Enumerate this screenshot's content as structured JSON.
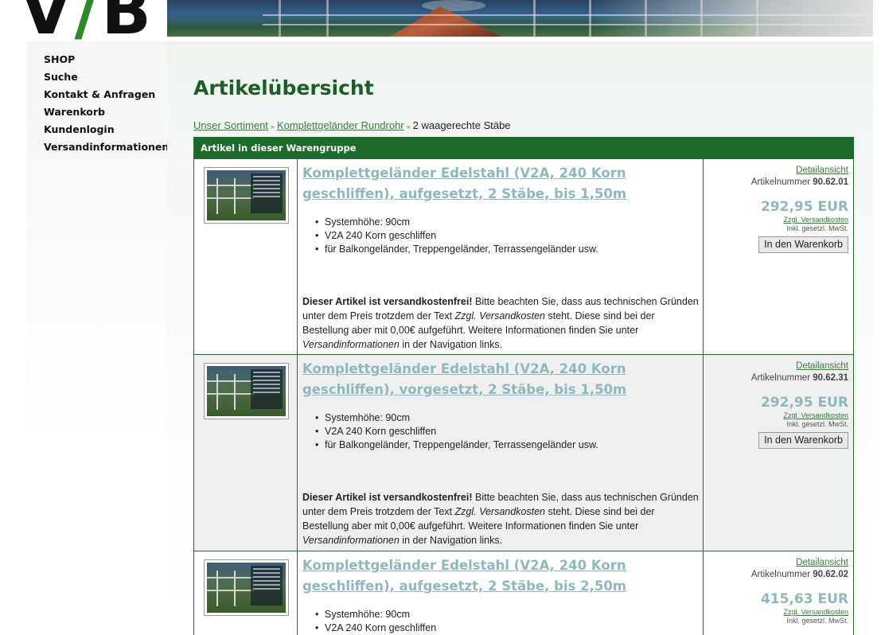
{
  "header": {
    "logo_text": "V/B"
  },
  "sidebar": {
    "items": [
      {
        "label": "SHOP"
      },
      {
        "label": "Suche"
      },
      {
        "label": "Kontakt & Anfragen"
      },
      {
        "label": "Warenkorb"
      },
      {
        "label": "Kundenlogin"
      },
      {
        "label": "Versandinformationen"
      }
    ]
  },
  "main": {
    "title": "Artikelübersicht",
    "breadcrumb": {
      "link1": "Unser Sortiment",
      "link2": "Komplettgeländer Rundrohr",
      "current": "2 waagerechte Stäbe",
      "separator": "»"
    },
    "table_header": "Artikel in dieser Warengruppe",
    "products": [
      {
        "title": "Komplettgeländer Edelstahl (V2A, 240 Korn geschliffen), aufgesetzt, 2 Stäbe, bis 1,50m",
        "features": [
          "Systemhöhe: 90cm",
          "V2A 240 Korn geschliffen",
          "für Balkongeländer, Treppengeländer, Terrassengeländer usw."
        ],
        "note_bold": "Dieser Artikel ist versandkostenfrei!",
        "note_text1": " Bitte beachten Sie, dass aus technischen Gründen unter dem Preis trotzdem der Text ",
        "note_italic1": "Zzgl. Versandkosten",
        "note_text2": " steht. Diese sind bei der Bestellung aber mit 0,00€ aufgeführt. Weitere Informationen finden Sie unter ",
        "note_italic2": "Versandinformationen",
        "note_text3": " in der Navigation links.",
        "detail_link": "Detailansicht",
        "artnr_label": "Artikelnummer",
        "artnr": "90.62.01",
        "price": "292,95 EUR",
        "shipping": "Zzgl. Versandkosten",
        "vat": "Inkl. gesetzl. MwSt.",
        "cart_button": "In den Warenkorb"
      },
      {
        "title": "Komplettgeländer Edelstahl (V2A, 240 Korn geschliffen), vorgesetzt, 2 Stäbe, bis 1,50m",
        "features": [
          "Systemhöhe: 90cm",
          "V2A 240 Korn geschliffen",
          "für Balkongeländer, Treppengeländer, Terrassengeländer usw."
        ],
        "note_bold": "Dieser Artikel ist versandkostenfrei!",
        "note_text1": " Bitte beachten Sie, dass aus technischen Gründen unter dem Preis trotzdem der Text ",
        "note_italic1": "Zzgl. Versandkosten",
        "note_text2": " steht. Diese sind bei der Bestellung aber mit 0,00€ aufgeführt. Weitere Informationen finden Sie unter ",
        "note_italic2": "Versandinformationen",
        "note_text3": " in der Navigation links.",
        "detail_link": "Detailansicht",
        "artnr_label": "Artikelnummer",
        "artnr": "90.62.31",
        "price": "292,95 EUR",
        "shipping": "Zzgl. Versandkosten",
        "vat": "Inkl. gesetzl. MwSt.",
        "cart_button": "In den Warenkorb"
      },
      {
        "title": "Komplettgeländer Edelstahl (V2A, 240 Korn geschliffen), aufgesetzt, 2 Stäbe, bis 2,50m",
        "features": [
          "Systemhöhe: 90cm",
          "V2A 240 Korn geschliffen"
        ],
        "detail_link": "Detailansicht",
        "artnr_label": "Artikelnummer",
        "artnr": "90.62.02",
        "price": "415,63 EUR",
        "shipping": "Zzgl. Versandkosten",
        "vat": "Inkl. gesetzl. MwSt."
      }
    ]
  },
  "colors": {
    "accent_green": "#1d6b2a",
    "title_green": "#1d5e28",
    "link_green": "#3a7d3a",
    "product_link": "#8fb8be"
  }
}
